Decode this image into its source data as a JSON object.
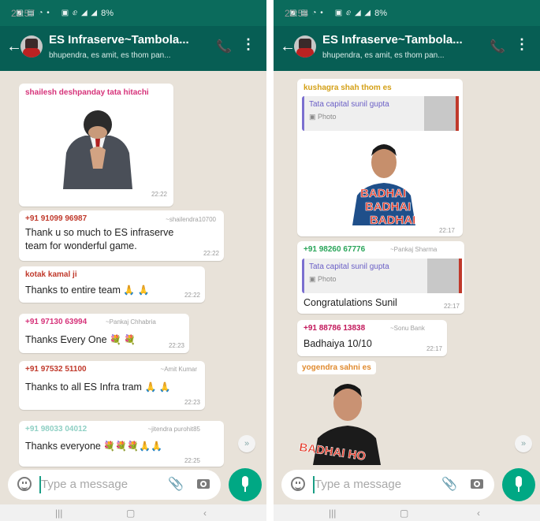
{
  "left": {
    "status": {
      "time": "22:57",
      "battery": "8%"
    },
    "header": {
      "title": "ES Infraserve~Tambola...",
      "subtitle": "bhupendra, es amit, es thom pan..."
    },
    "sticker1": {
      "sender": "shailesh deshpanday tata hitachi",
      "time": "22:22"
    },
    "msg1": {
      "phone": "+91 91099 96987",
      "tag": "~shailendra10700",
      "text_line1": "Thank u so much to ES infraserve",
      "text_line2": "team for wonderful game.",
      "time": "22:22"
    },
    "msg2": {
      "sender": "kotak kamal ji",
      "text": "Thanks to entire team",
      "time": "22:22"
    },
    "msg3": {
      "phone": "+91 97130 63994",
      "tag": "~Pankaj Chhabria",
      "text": "Thanks Every One",
      "time": "22:23"
    },
    "msg4": {
      "phone": "+91 97532 51100",
      "tag": "~Amit Kumar",
      "text": "Thanks to all ES Infra tram",
      "time": "22:23"
    },
    "msg5": {
      "phone": "+91 98033 04012",
      "tag": "~jitendra purohit85",
      "text": "Thanks everyone",
      "time": "22:25"
    },
    "input": {
      "placeholder": "Type a message"
    }
  },
  "right": {
    "status": {
      "time": "22:58",
      "battery": "8%"
    },
    "header": {
      "title": "ES Infraserve~Tambola...",
      "subtitle": "bhupendra, es amit, es thom pan..."
    },
    "sticker1": {
      "sender": "kushagra shah thom es",
      "quote_name": "Tata capital sunil gupta",
      "quote_type": "Photo",
      "sticker_text1": "BADHAI",
      "sticker_text2": "BADHAI",
      "sticker_text3": "BADHAI",
      "time": "22:17"
    },
    "msg1": {
      "phone": "+91 98260 67776",
      "tag": "~Pankaj Sharma",
      "quote_name": "Tata capital sunil gupta",
      "quote_type": "Photo",
      "text": "Congratulations Sunil",
      "time": "22:17"
    },
    "msg2": {
      "phone": "+91 88786 13838",
      "tag": "~Sonu Bank",
      "text": "Badhaiya 10/10",
      "time": "22:17"
    },
    "sticker2": {
      "sender": "yogendra sahni es",
      "sticker_text": "BADHAI HO"
    },
    "input": {
      "placeholder": "Type a message"
    }
  },
  "colors": {
    "header": "#075e54",
    "statusbar": "#0b6b5c",
    "accent": "#00a884",
    "chat_bg": "#e8e2d9"
  }
}
